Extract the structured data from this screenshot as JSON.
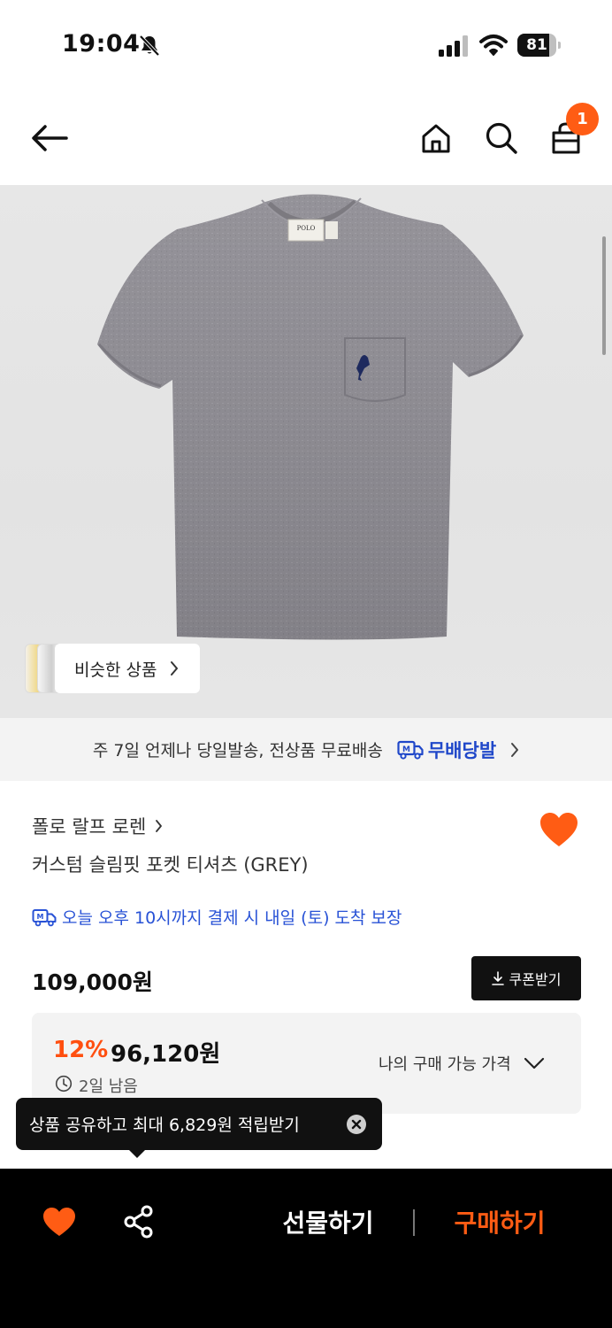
{
  "status_bar": {
    "time": "19:04",
    "battery_level": "81",
    "battery_fraction": 0.81,
    "icons": [
      "bell-muted-icon",
      "cellular-signal-icon",
      "wifi-icon",
      "battery-icon"
    ]
  },
  "nav": {
    "cart_badge_count": "1",
    "icons": [
      "back-arrow-icon",
      "home-icon",
      "search-icon",
      "shopping-bag-icon"
    ]
  },
  "image": {
    "similar_label": "비슷한 상품"
  },
  "delivery_banner": {
    "text": "주 7일 언제나 당일발송, 전상품 무료배송",
    "service_name": "무배당발"
  },
  "product": {
    "brand": "폴로 랄프 로렌",
    "name": "커스텀 슬림핏 포켓 티셔츠 (GREY)",
    "delivery_guarantee": "오늘 오후 10시까지 결제 시 내일 (토) 도착 보장",
    "original_price": "109,000원",
    "coupon_label": "쿠폰받기",
    "discount_rate": "12%",
    "sale_price": "96,120원",
    "time_remaining": "2일 남음",
    "my_price_label": "나의 구매 가능 가격"
  },
  "tooltip": {
    "text": "상품 공유하고 최대 6,829원 적립받기"
  },
  "bottom_bar": {
    "gift_label": "선물하기",
    "buy_label": "구매하기"
  },
  "colors": {
    "accent_orange": "#ff5c14",
    "discount_orange": "#ff4f10",
    "guarantee_blue": "#2852d6",
    "service_blue": "#1f47c9",
    "bottom_bar_bg": "#000000"
  }
}
